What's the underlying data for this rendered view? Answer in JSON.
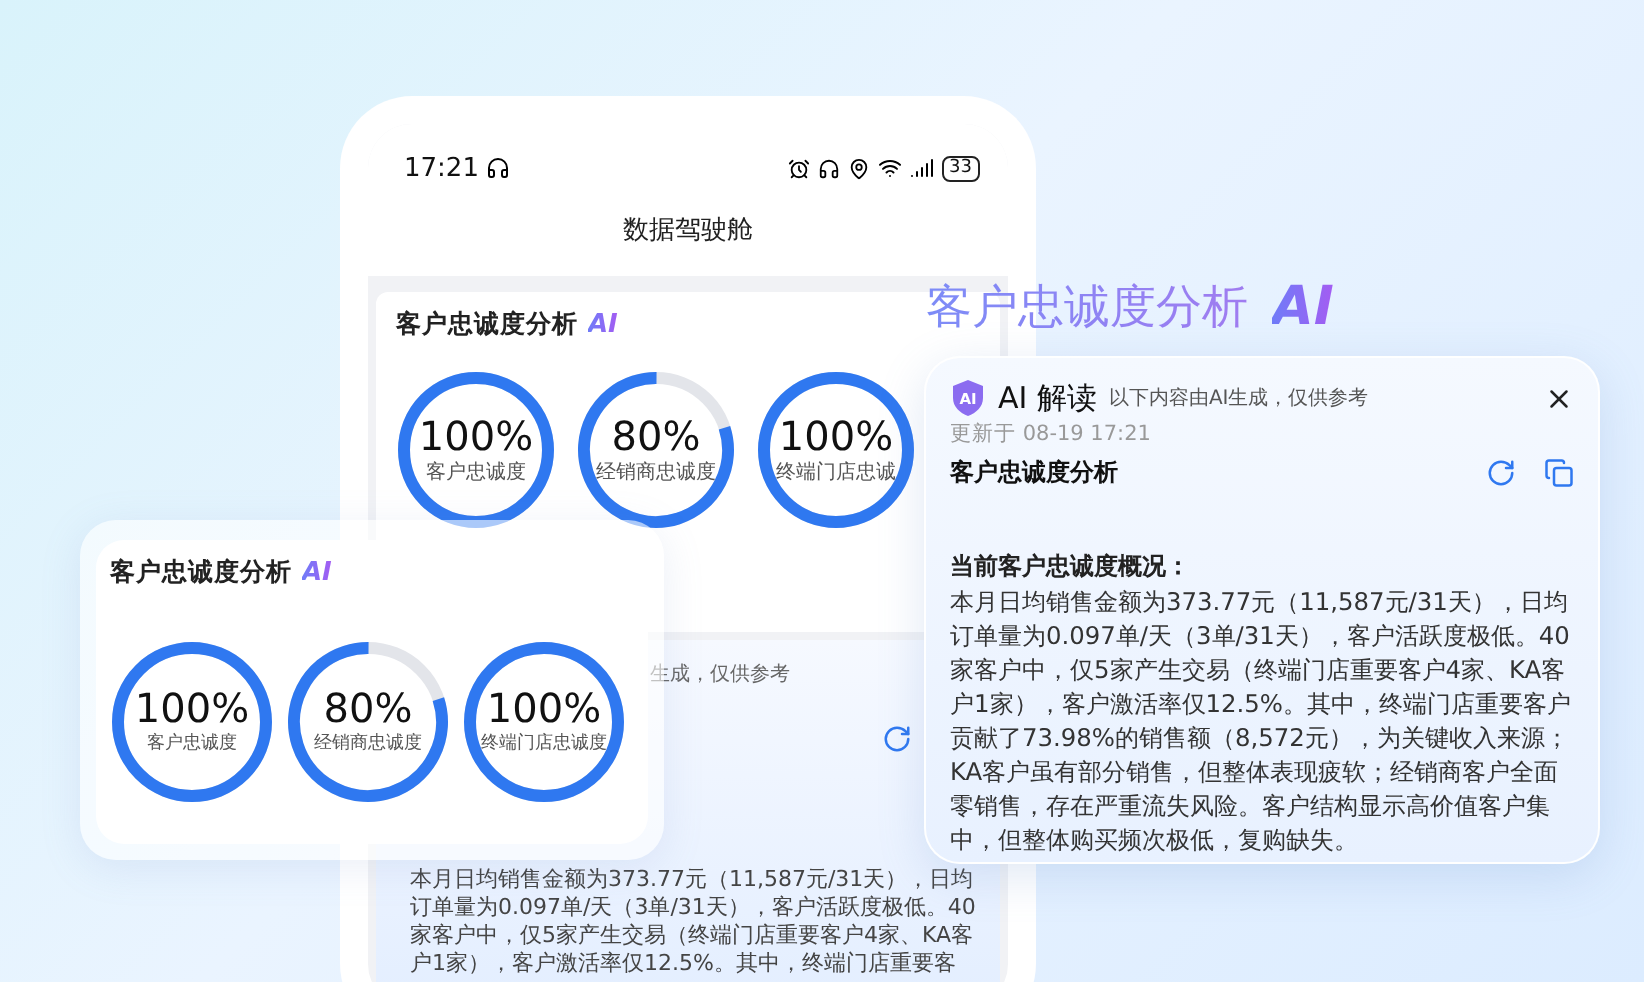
{
  "phone": {
    "status_bar": {
      "time": "17:21",
      "battery": "33"
    },
    "title": "数据驾驶舱",
    "card": {
      "title": "客户忠诚度分析",
      "badge": "AI",
      "rings": [
        {
          "value": "100%",
          "label": "客户忠诚度",
          "level": 1
        },
        {
          "value": "80%",
          "label": "经销商忠诚度",
          "level": 0.8
        },
        {
          "value": "100%",
          "label": "终端门店忠诚",
          "level": 1
        }
      ]
    },
    "ai_panel": {
      "disclaimer": "生成，仅供参考",
      "body": "本月日均销售金额为373.77元（11,587元/31天），日均订单量为0.097单/天（3单/31天），客户活跃度极低。40家客户中，仅5家产生交易（终端门店重要客户4家、KA客户1家），客户激活率仅12.5%。其中，终端门店重要客"
    }
  },
  "headline": {
    "title": "客户忠诚度分析",
    "badge": "AI"
  },
  "loyalty_card": {
    "title": "客户忠诚度分析",
    "badge": "AI",
    "rings": [
      {
        "value": "100%",
        "label": "客户忠诚度",
        "level": 1
      },
      {
        "value": "80%",
        "label": "经销商忠诚度",
        "level": 0.8
      },
      {
        "value": "100%",
        "label": "终端门店忠诚度",
        "level": 1
      }
    ]
  },
  "ai_dialog": {
    "shield_label": "AI",
    "title": "AI 解读",
    "disclaimer": "以下内容由AI生成，仅供参考",
    "updated": "更新于 08-19 17:21",
    "subtitle": "客户忠诚度分析",
    "heading": "当前客户忠诚度概况：",
    "body": "本月日均销售金额为373.77元（11,587元/31天），日均订单量为0.097单/天（3单/31天），客户活跃度极低。40家客户中，仅5家产生交易（终端门店重要客户4家、KA客户1家），客户激活率仅12.5%。其中，终端门店重要客户贡献了73.98%的销售额（8,572元），为关键收入来源；KA客户虽有部分销售，但整体表现疲软；经销商客户全面零销售，存在严重流失风险。客户结构显示高价值客户集中，但整体购买频次极低，复购缺失。"
  }
}
